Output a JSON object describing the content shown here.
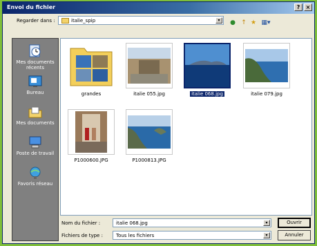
{
  "window": {
    "title": "Envoi du fichier"
  },
  "title_buttons": {
    "help": "?",
    "close": "×"
  },
  "lookin": {
    "label": "Regarder dans :",
    "value": "italie_spip",
    "arrow": "▾"
  },
  "toolbar": {
    "back": "●",
    "up": "↑",
    "newfolder": "★",
    "views": "▦▾"
  },
  "places": [
    {
      "label": "Mes documents récents",
      "icon": "recent-documents-icon"
    },
    {
      "label": "Bureau",
      "icon": "desktop-icon"
    },
    {
      "label": "Mes documents",
      "icon": "my-documents-icon"
    },
    {
      "label": "Poste de travail",
      "icon": "my-computer-icon"
    },
    {
      "label": "Favoris réseau",
      "icon": "network-icon"
    }
  ],
  "files": [
    {
      "name": "grandes",
      "type": "folder",
      "selected": false
    },
    {
      "name": "italie 055.jpg",
      "type": "image",
      "selected": false
    },
    {
      "name": "italie 068.jpg",
      "type": "image",
      "selected": true
    },
    {
      "name": "italie 079.jpg",
      "type": "image",
      "selected": false
    },
    {
      "name": "P1000600.JPG",
      "type": "image",
      "selected": false
    },
    {
      "name": "P1000813.JPG",
      "type": "image",
      "selected": false
    }
  ],
  "filename": {
    "label": "Nom du fichier :",
    "value": "italie 068.jpg"
  },
  "filetype": {
    "label": "Fichiers de type :",
    "value": "Tous les fichiers"
  },
  "buttons": {
    "open": "Ouvrir",
    "cancel": "Annuler"
  }
}
